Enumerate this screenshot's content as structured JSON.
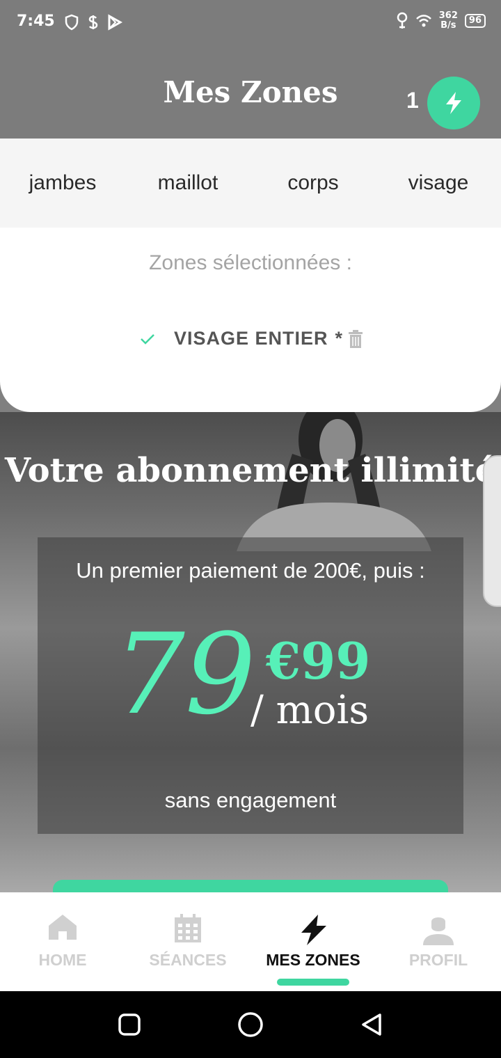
{
  "status_bar": {
    "time": "7:45",
    "network_speed_value": "362",
    "network_speed_unit": "B/s",
    "battery": "96"
  },
  "header": {
    "title": "Mes Zones",
    "zone_count": "1",
    "accent_color": "#3fd6a0"
  },
  "zone_tabs": [
    {
      "label": "jambes"
    },
    {
      "label": "maillot"
    },
    {
      "label": "corps"
    },
    {
      "label": "visage"
    }
  ],
  "selection": {
    "title": "Zones sélectionnées :",
    "items": [
      {
        "label": "VISAGE ENTIER",
        "marker": "*"
      }
    ]
  },
  "offer": {
    "title": "Votre abonnement illimité",
    "first_payment": "Un premier paiement de 200€, puis :",
    "price_main": "79",
    "price_cents": "€99",
    "price_period": "/ mois",
    "note": "sans engagement",
    "price_color": "#57f0b8"
  },
  "bottom_nav": {
    "items": [
      {
        "label": "HOME",
        "icon": "home-icon",
        "active": false
      },
      {
        "label": "SÉANCES",
        "icon": "calendar-icon",
        "active": false
      },
      {
        "label": "MES ZONES",
        "icon": "bolt-icon",
        "active": true
      },
      {
        "label": "PROFIL",
        "icon": "user-icon",
        "active": false
      }
    ]
  }
}
